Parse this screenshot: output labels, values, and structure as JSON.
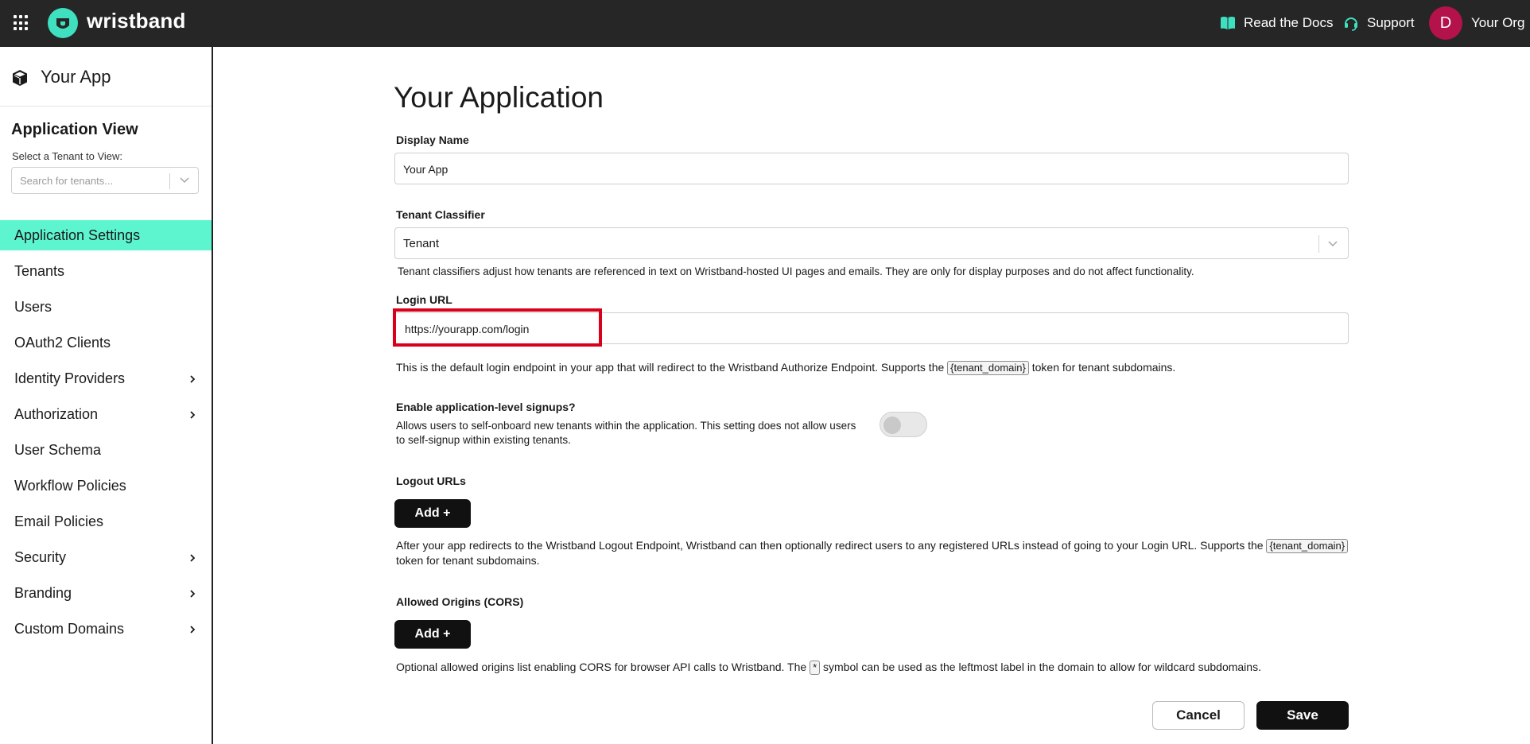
{
  "topbar": {
    "brand": "wristband",
    "docs_label": "Read the Docs",
    "support_label": "Support",
    "avatar_initial": "D",
    "org_name": "Your Org",
    "accent": "#3fe0c0",
    "avatar_color": "#b3124a"
  },
  "sidebar": {
    "app_name": "Your App",
    "view_title": "Application View",
    "tenant_label": "Select a Tenant to View:",
    "tenant_placeholder": "Search for tenants...",
    "active_color": "#5cf5cf",
    "items": [
      {
        "label": "Application Settings",
        "active": true,
        "has_submenu": false
      },
      {
        "label": "Tenants",
        "has_submenu": false
      },
      {
        "label": "Users",
        "has_submenu": false
      },
      {
        "label": "OAuth2 Clients",
        "has_submenu": false
      },
      {
        "label": "Identity Providers",
        "has_submenu": true
      },
      {
        "label": "Authorization",
        "has_submenu": true
      },
      {
        "label": "User Schema",
        "has_submenu": false
      },
      {
        "label": "Workflow Policies",
        "has_submenu": false
      },
      {
        "label": "Email Policies",
        "has_submenu": false
      },
      {
        "label": "Security",
        "has_submenu": true
      },
      {
        "label": "Branding",
        "has_submenu": true
      },
      {
        "label": "Custom Domains",
        "has_submenu": true
      }
    ]
  },
  "main": {
    "title": "Your Application",
    "display_name": {
      "label": "Display Name",
      "value": "Your App"
    },
    "tenant_classifier": {
      "label": "Tenant Classifier",
      "value": "Tenant",
      "help": "Tenant classifiers adjust how tenants are referenced in text on Wristband-hosted UI pages and emails. They are only for display purposes and do not affect functionality."
    },
    "login_url": {
      "label": "Login URL",
      "value": "https://yourapp.com/login",
      "help_before": "This is the default login endpoint in your app that will redirect to the Wristband Authorize Endpoint. Supports the",
      "token": "{tenant_domain}",
      "help_after": "token for tenant subdomains."
    },
    "signups": {
      "label": "Enable application-level signups?",
      "help_line1": "Allows users to self-onboard new tenants within the application. This setting does not allow users",
      "help_line2": "to self-signup within existing tenants.",
      "enabled": false
    },
    "logout_urls": {
      "label": "Logout URLs",
      "add_label": "Add +",
      "help_before": "After your app redirects to the Wristband Logout Endpoint, Wristband can then optionally redirect users to any registered URLs instead of going to your Login URL. Supports the",
      "token": "{tenant_domain}",
      "help_after": "token for tenant subdomains."
    },
    "cors": {
      "label": "Allowed Origins (CORS)",
      "add_label": "Add +",
      "help_before": "Optional allowed origins list enabling CORS for browser API calls to Wristband. The",
      "token": "*",
      "help_after": "symbol can be used as the leftmost label in the domain to allow for wildcard subdomains."
    },
    "cancel_label": "Cancel",
    "save_label": "Save"
  }
}
